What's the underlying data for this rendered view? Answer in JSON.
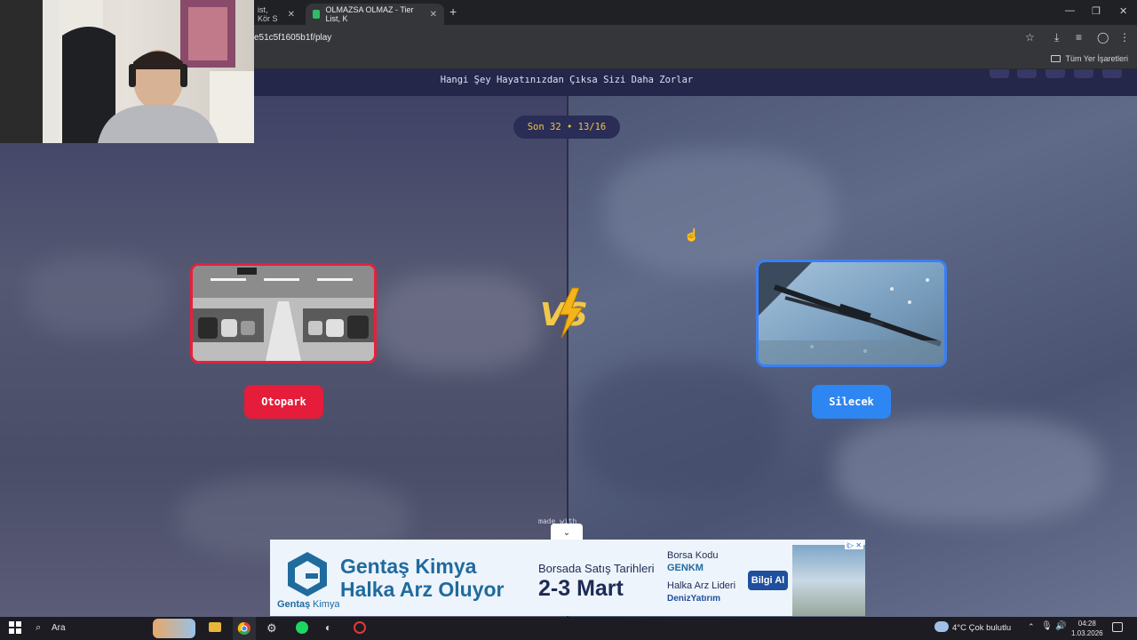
{
  "browser": {
    "tabs": [
      {
        "label": "ist, Kör S",
        "active": false
      },
      {
        "label": "OLMAZSA OLMAZ - Tier List, K",
        "active": true
      }
    ],
    "url": "e51c5f1605b1f/play",
    "bookmarks_all": "Tüm Yer İşaretleri"
  },
  "page": {
    "question": "Hangi Şey Hayatınızdan Çıksa Sizi Daha Zorlar",
    "counter": "Son 32 • 13/16",
    "left_choice": {
      "label": "Otopark",
      "image": "parking-garage-photo"
    },
    "right_choice": {
      "label": "Silecek",
      "image": "windshield-wiper-photo"
    },
    "vs_icon": "vs-lightning-icon",
    "made_with": "made with"
  },
  "ad": {
    "brand": "Gentaş Kimya",
    "title_line1": "Gentaş Kimya",
    "title_line2": "Halka Arz Oluyor",
    "dates_label": "Borsada Satış Tarihleri",
    "dates": "2-3 Mart",
    "code_label": "Borsa Kodu",
    "code": "GENKM",
    "leader_label": "Halka Arz Lideri",
    "leader": "DenizYatırım",
    "info_button": "Bilgi Al",
    "mark": "i▷ ✕"
  },
  "taskbar": {
    "search": "Ara",
    "weather": "4°C  Çok bulutlu",
    "time": "04:28",
    "date": "1.03.2026"
  },
  "colors": {
    "left_accent": "#e51c3a",
    "right_accent": "#2e86f2",
    "counter_text": "#f0c24a"
  }
}
